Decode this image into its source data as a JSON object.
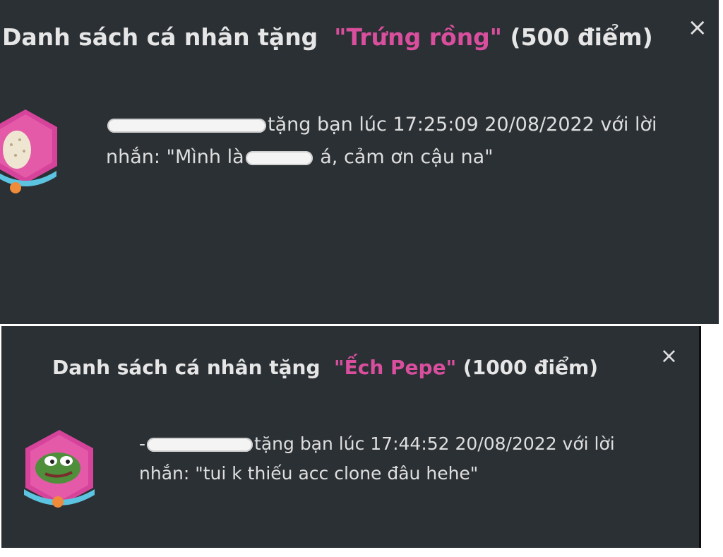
{
  "panels": [
    {
      "title_prefix": "Danh sách cá nhân tặng",
      "gift_name": "\"Trứng rồng\"",
      "points": "(500 điểm)",
      "close": "×",
      "message_line1": "tặng bạn lúc 17:25:09 20/08/2022 với lời",
      "message_line2a": "nhắn: \"Mình là",
      "message_line2b": "á, cảm ơn cậu na\"",
      "avatar_icon": "dragon-egg-badge-icon"
    },
    {
      "title_prefix": "Danh sách cá nhân tặng",
      "gift_name": "\"Ếch Pepe\"",
      "points": "(1000 điểm)",
      "close": "×",
      "message_prefix": "-",
      "message_line1": "tặng bạn lúc 17:44:52 20/08/2022 với lời",
      "message_line2": "nhắn: \"tui k thiếu acc clone đâu hehe\"",
      "avatar_icon": "pepe-frog-badge-icon"
    }
  ],
  "colors": {
    "panel_bg": "#2b3034",
    "accent": "#d94f9e"
  }
}
